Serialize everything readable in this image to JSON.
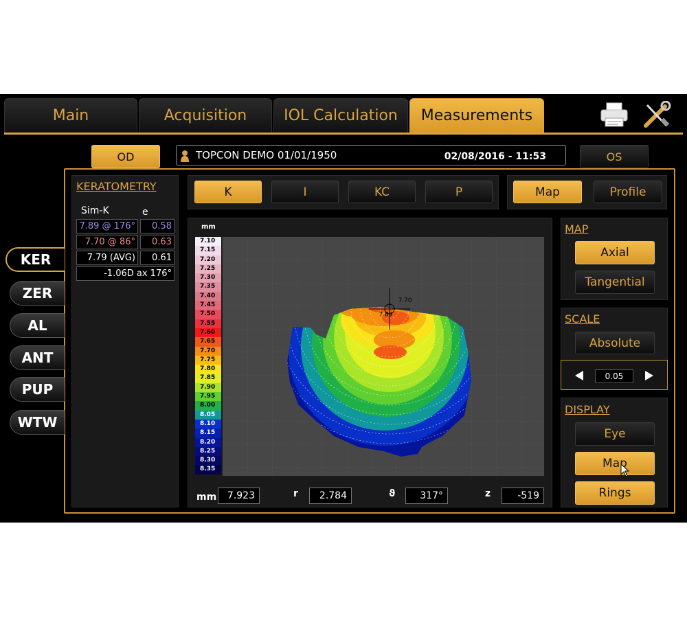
{
  "tabs": [
    {
      "label": "Main"
    },
    {
      "label": "Acquisition"
    },
    {
      "label": "IOL Calculation"
    },
    {
      "label": "Measurements"
    }
  ],
  "icons": {
    "print": "printer-icon",
    "tools": "tools-icon"
  },
  "eye": {
    "od": "OD",
    "os": "OS"
  },
  "patient": {
    "name": "TOPCON DEMO 01/01/1950",
    "datetime": "02/08/2016 - 11:53"
  },
  "side_tabs": [
    "KER",
    "ZER",
    "AL",
    "ANT",
    "PUP",
    "WTW"
  ],
  "keratometry": {
    "title": "KERATOMETRY",
    "col1": "Sim-K",
    "col2": "e",
    "rows": [
      {
        "k": "7.89 @ 176°",
        "e": "0.58"
      },
      {
        "k": "7.70 @ 86°",
        "e": "0.63"
      },
      {
        "k": "7.79 (AVG)",
        "e": "0.61"
      }
    ],
    "cyl": "-1.06D ax 176°"
  },
  "mode_buttons": [
    "K",
    "I",
    "KC",
    "P"
  ],
  "view_buttons": [
    "Map",
    "Profile"
  ],
  "map_panel": {
    "title": "MAP",
    "axial": "Axial",
    "tangential": "Tangential"
  },
  "scale_panel": {
    "title": "SCALE",
    "absolute": "Absolute",
    "step": "0.05"
  },
  "display_panel": {
    "title": "DISPLAY",
    "eye": "Eye",
    "map": "Map",
    "rings": "Rings"
  },
  "chart_data": {
    "type": "heatmap",
    "unit": "mm",
    "scale": [
      {
        "v": "7.10",
        "c": "#f4eef8"
      },
      {
        "v": "7.15",
        "c": "#f0dce8"
      },
      {
        "v": "7.20",
        "c": "#ecc8d8"
      },
      {
        "v": "7.25",
        "c": "#e8b4c4"
      },
      {
        "v": "7.30",
        "c": "#e4a0b0"
      },
      {
        "v": "7.35",
        "c": "#e08c9c"
      },
      {
        "v": "7.40",
        "c": "#dc7888"
      },
      {
        "v": "7.45",
        "c": "#e06878"
      },
      {
        "v": "7.50",
        "c": "#e84c5c"
      },
      {
        "v": "7.55",
        "c": "#ec3040"
      },
      {
        "v": "7.60",
        "c": "#f01818"
      },
      {
        "v": "7.65",
        "c": "#f05a14"
      },
      {
        "v": "7.70",
        "c": "#f49010"
      },
      {
        "v": "7.75",
        "c": "#f8bc10"
      },
      {
        "v": "7.80",
        "c": "#f8e418"
      },
      {
        "v": "7.85",
        "c": "#e0f020"
      },
      {
        "v": "7.90",
        "c": "#a8e428"
      },
      {
        "v": "7.95",
        "c": "#60d030"
      },
      {
        "v": "8.00",
        "c": "#20b048"
      },
      {
        "v": "8.05",
        "c": "#10989c"
      },
      {
        "v": "8.10",
        "c": "#0830c8"
      },
      {
        "v": "8.15",
        "c": "#0420b4"
      },
      {
        "v": "8.20",
        "c": "#04149c"
      },
      {
        "v": "8.25",
        "c": "#040c80"
      },
      {
        "v": "8.30",
        "c": "#040864"
      },
      {
        "v": "8.35",
        "c": "#04044c"
      }
    ],
    "annotations": [
      {
        "text": "7.70",
        "x": 0.9,
        "y": -0.35
      },
      {
        "text": "7.89",
        "x": -1.1,
        "y": 0.6
      }
    ]
  },
  "readouts": {
    "mm_label": "mm",
    "mm": "7.923",
    "r_label": "r",
    "r": "2.784",
    "theta_label": "ϑ",
    "theta": "317°",
    "z_label": "z",
    "z": "-519"
  },
  "colors": {
    "accent": "#d9a441",
    "sim_k1": "#9b8ff0",
    "sim_k2": "#ef8b8b"
  }
}
